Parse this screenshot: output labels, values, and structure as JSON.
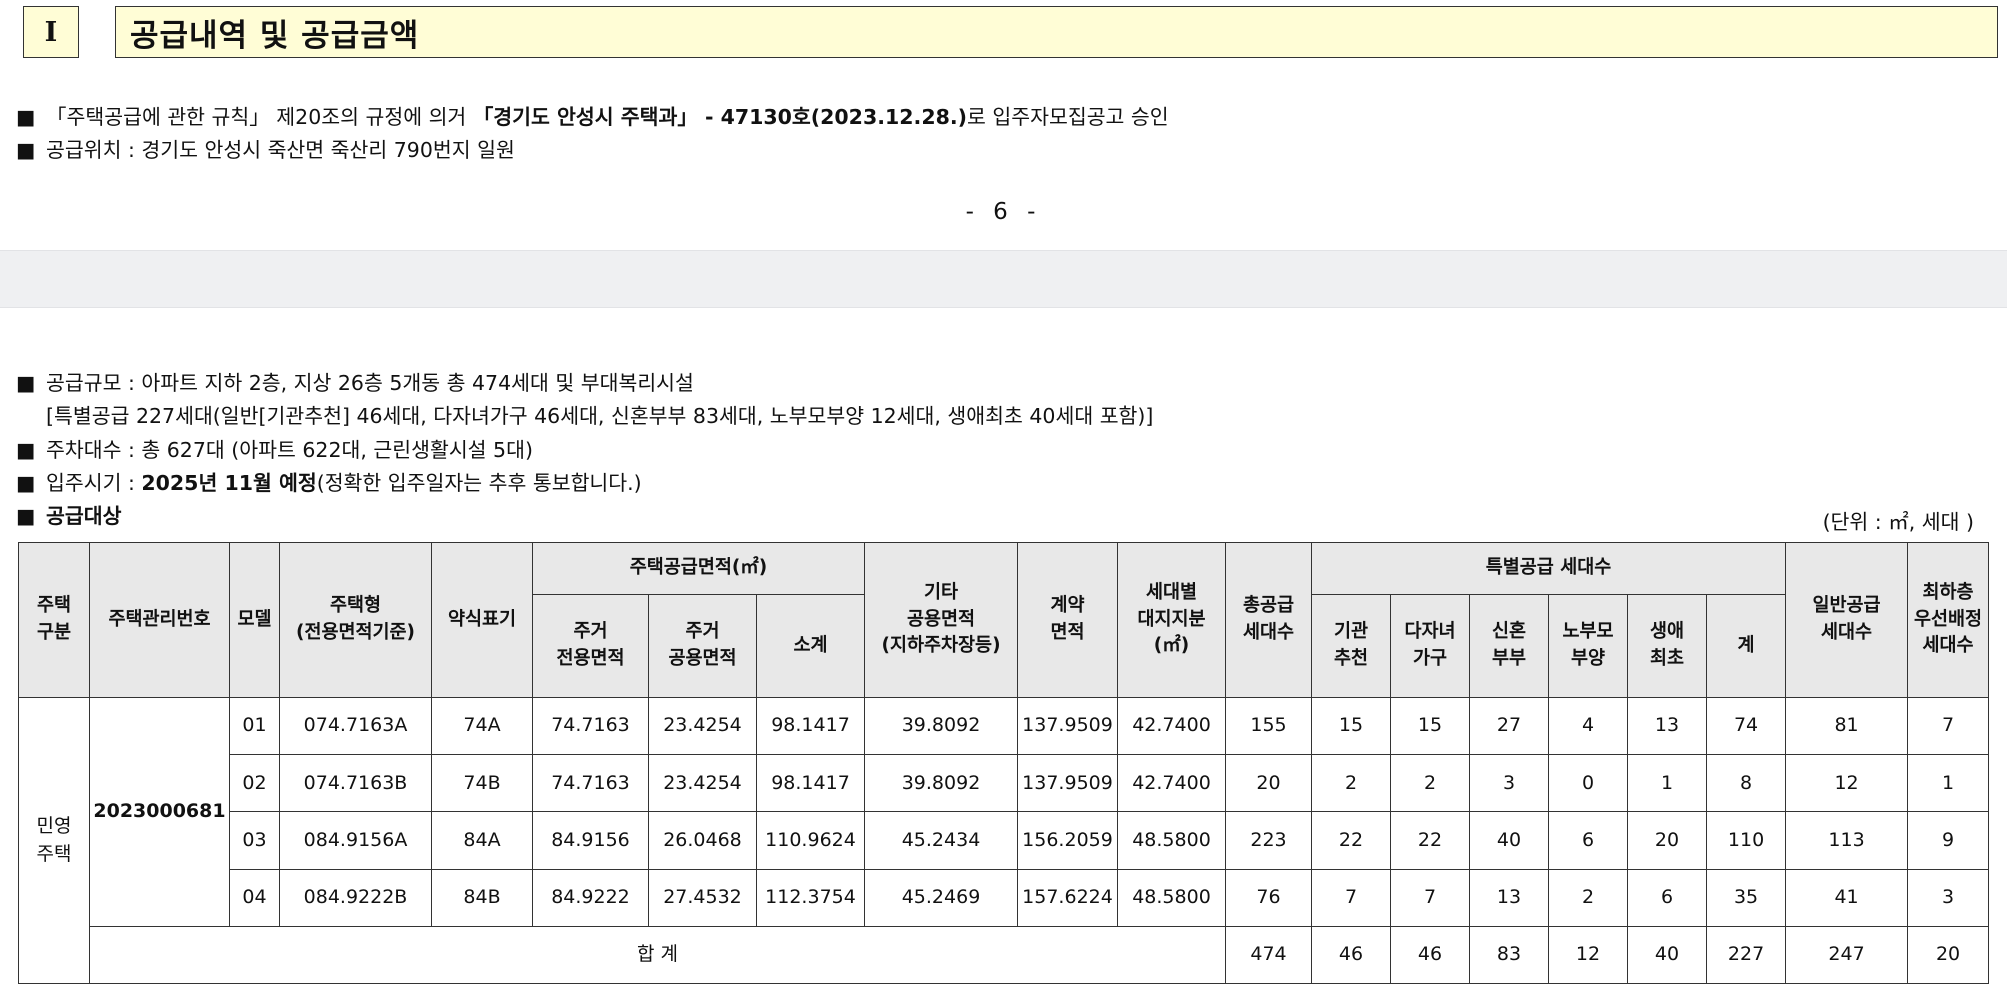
{
  "section": {
    "number": "I",
    "title": "공급내역 및 공급금액"
  },
  "intro": {
    "bullet": "■",
    "line1_a": "「주택공급에 관한 규칙」 제20조의 규정에 의거 ",
    "line1_b": "「경기도 안성시 주택과」 - 47130호(2023.12.28.)",
    "line1_c": "로 입주자모집공고 승인",
    "line2": "공급위치 : 경기도 안성시 죽산면 죽산리 790번지 일원"
  },
  "page_number": "- 6 -",
  "details": {
    "scale_1": "공급규모 : 아파트 지하 2층, 지상 26층 5개동 총 474세대 및 부대복리시설",
    "scale_2": "[특별공급 227세대(일반[기관추천] 46세대, 다자녀가구 46세대, 신혼부부 83세대, 노부모부양 12세대, 생애최초 40세대 포함)]",
    "parking": "주차대수 : 총 627대 (아파트 622대, 근린생활시설 5대)",
    "movein_a": "입주시기 : ",
    "movein_b": "2025년 11월 예정",
    "movein_c": "(정확한 입주일자는 추후 통보합니다.)",
    "target": "공급대상",
    "unit": "(단위 : ㎡, 세대 )"
  },
  "table": {
    "headers": {
      "housing_type": [
        "주택",
        "구분"
      ],
      "mgmt_no": "주택관리번호",
      "model": "모델",
      "house_type": [
        "주택형",
        "(전용면적기준)"
      ],
      "short": "약식표기",
      "supply_area": "주택공급면적(㎡)",
      "exclusive": [
        "주거",
        "전용면적"
      ],
      "common": [
        "주거",
        "공용면적"
      ],
      "subtotal": "소계",
      "other_common": [
        "기타",
        "공용면적",
        "(지하주차장등)"
      ],
      "contract": [
        "계약",
        "면적"
      ],
      "land_share": [
        "세대별",
        "대지지분",
        "(㎡)"
      ],
      "total_units": [
        "총공급",
        "세대수"
      ],
      "special": "특별공급 세대수",
      "institution": [
        "기관",
        "추천"
      ],
      "multichild": [
        "다자녀",
        "가구"
      ],
      "newlywed": [
        "신혼",
        "부부"
      ],
      "elderly": [
        "노부모",
        "부양"
      ],
      "first_time": [
        "생애",
        "최초"
      ],
      "special_sum": "계",
      "general": [
        "일반공급",
        "세대수"
      ],
      "lowest_floor": [
        "최하층",
        "우선배정",
        "세대수"
      ]
    },
    "housing_type_value": [
      "민영",
      "주택"
    ],
    "mgmt_no_value": "2023000681",
    "rows": [
      {
        "model": "01",
        "type": "074.7163A",
        "short": "74A",
        "excl": "74.7163",
        "comm": "23.4254",
        "sub": "98.1417",
        "other": "39.8092",
        "contract": "137.9509",
        "land": "42.7400",
        "total": "155",
        "inst": "15",
        "multi": "15",
        "newly": "27",
        "elder": "4",
        "first": "13",
        "sp_sum": "74",
        "general": "81",
        "lowest": "7"
      },
      {
        "model": "02",
        "type": "074.7163B",
        "short": "74B",
        "excl": "74.7163",
        "comm": "23.4254",
        "sub": "98.1417",
        "other": "39.8092",
        "contract": "137.9509",
        "land": "42.7400",
        "total": "20",
        "inst": "2",
        "multi": "2",
        "newly": "3",
        "elder": "0",
        "first": "1",
        "sp_sum": "8",
        "general": "12",
        "lowest": "1"
      },
      {
        "model": "03",
        "type": "084.9156A",
        "short": "84A",
        "excl": "84.9156",
        "comm": "26.0468",
        "sub": "110.9624",
        "other": "45.2434",
        "contract": "156.2059",
        "land": "48.5800",
        "total": "223",
        "inst": "22",
        "multi": "22",
        "newly": "40",
        "elder": "6",
        "first": "20",
        "sp_sum": "110",
        "general": "113",
        "lowest": "9"
      },
      {
        "model": "04",
        "type": "084.9222B",
        "short": "84B",
        "excl": "84.9222",
        "comm": "27.4532",
        "sub": "112.3754",
        "other": "45.2469",
        "contract": "157.6224",
        "land": "48.5800",
        "total": "76",
        "inst": "7",
        "multi": "7",
        "newly": "13",
        "elder": "2",
        "first": "6",
        "sp_sum": "35",
        "general": "41",
        "lowest": "3"
      }
    ],
    "totals": {
      "label": "합 계",
      "total": "474",
      "inst": "46",
      "multi": "46",
      "newly": "83",
      "elder": "12",
      "first": "40",
      "sp_sum": "227",
      "general": "247",
      "lowest": "20"
    }
  }
}
